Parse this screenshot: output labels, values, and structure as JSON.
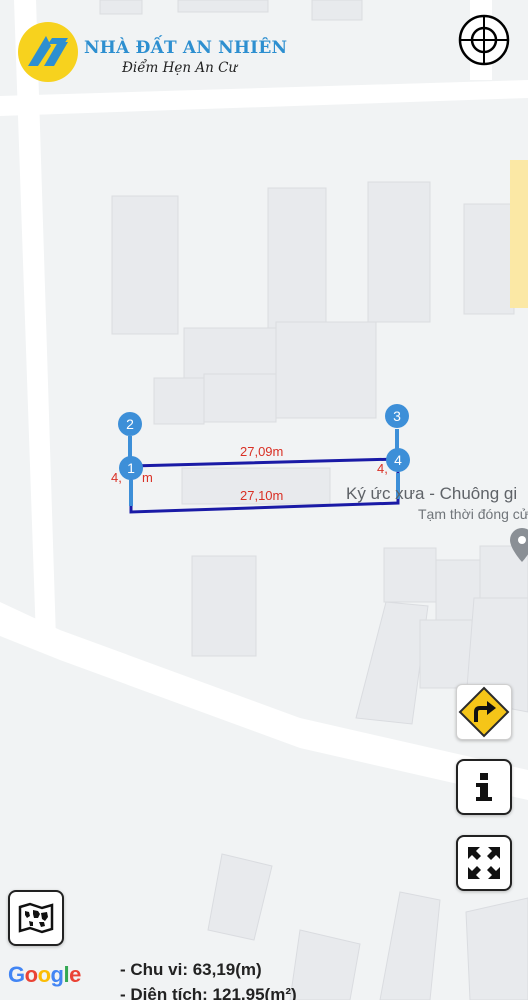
{
  "brand": {
    "name": "NHÀ ĐẤT AN NHIÊN",
    "slogan": "Điểm Hẹn An Cư",
    "colors": {
      "yellow": "#f7d21e",
      "blue": "#2d8fd0"
    }
  },
  "map": {
    "provider": "Google",
    "poi": {
      "name": "Ký ức xưa - Chuông gi",
      "status": "Tạm thời đóng cử"
    },
    "parcel": {
      "line_color": "#1a1aa6",
      "edge_labels": [
        "27,09m",
        "27,10m",
        "4,",
        "m",
        "4,"
      ],
      "markers": [
        "1",
        "2",
        "3",
        "4"
      ],
      "marker_color": "#3d8fd8",
      "label_color": "#d93025"
    }
  },
  "controls": {
    "locate": "crosshair-icon",
    "directions": "turn-right-icon",
    "info": "info-icon",
    "fullscreen": "expand-icon",
    "map_type": "world-map-icon"
  },
  "stats": {
    "perimeter": "- Chu vi: 63,19(m)",
    "area": "- Diện tích: 121,95(m²)"
  }
}
